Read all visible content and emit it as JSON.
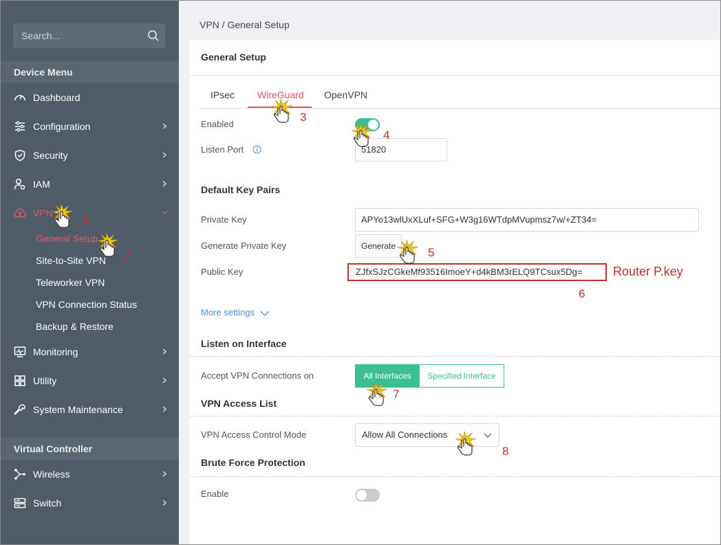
{
  "sidebar": {
    "search_placeholder": "Search...",
    "device_menu_header": "Device Menu",
    "virtual_controller_header": "Virtual Controller",
    "items": [
      {
        "label": "Dashboard"
      },
      {
        "label": "Configuration"
      },
      {
        "label": "Security"
      },
      {
        "label": "IAM"
      },
      {
        "label": "VPN"
      },
      {
        "label": "Monitoring"
      },
      {
        "label": "Utility"
      },
      {
        "label": "System Maintenance"
      }
    ],
    "vpn_sub_items": [
      {
        "label": "General Setup"
      },
      {
        "label": "Site-to-Site VPN"
      },
      {
        "label": "Teleworker VPN"
      },
      {
        "label": "VPN Connection Status"
      },
      {
        "label": "Backup & Restore"
      }
    ],
    "vc_items": [
      {
        "label": "Wireless"
      },
      {
        "label": "Switch"
      }
    ]
  },
  "breadcrumb": "VPN / General Setup",
  "panel": {
    "title": "General Setup",
    "tabs": [
      {
        "label": "IPsec"
      },
      {
        "label": "WireGuard"
      },
      {
        "label": "OpenVPN"
      }
    ],
    "enabled_label": "Enabled",
    "listen_port_label": "Listen Port",
    "listen_port_value": "51820",
    "default_key_pairs": "Default Key Pairs",
    "private_key_label": "Private Key",
    "private_key_value": "APYo13wlUxXLuf+SFG+W3g16WTdpMVupmsz7w/+ZT34=",
    "generate_private_key_label": "Generate Private Key",
    "generate_button": "Generate",
    "public_key_label": "Public Key",
    "public_key_value": "ZJfxSJzCGkeMf93516ImoeY+d4kBM3rELQ9TCsux5Dg=",
    "more_settings": "More settings",
    "listen_on_interface": "Listen on Interface",
    "accept_vpn_label": "Accept VPN Connections on",
    "all_interfaces": "All Interfaces",
    "specified_interface": "Specified Interface",
    "vpn_access_list": "VPN Access List",
    "vpn_access_control_mode_label": "VPN Access Control Mode",
    "vpn_access_control_mode_value": "Allow All Connections",
    "brute_force_protection": "Brute Force Protection",
    "enable_label": "Enable"
  },
  "annotations": {
    "router_pkey": "Router P.key",
    "steps": [
      "1",
      "2",
      "3",
      "4",
      "5",
      "6",
      "7",
      "8"
    ]
  },
  "colors": {
    "sidebar_bg": "#4f5b66",
    "accent_red": "#e5566b",
    "accent_green": "#3cbf95",
    "annotation_red": "#c0302f"
  }
}
